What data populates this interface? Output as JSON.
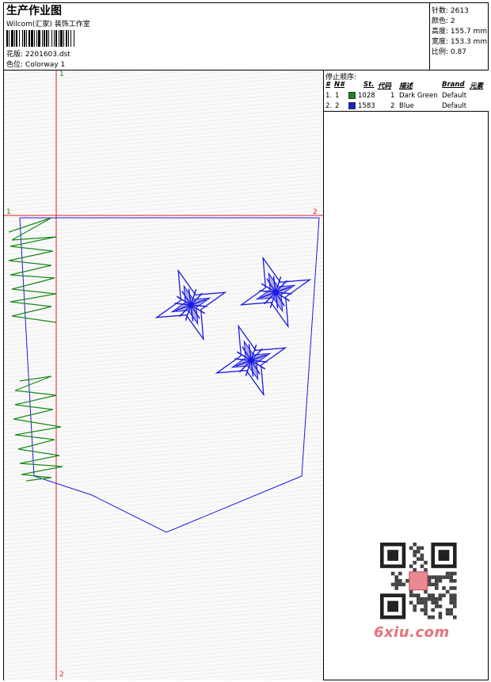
{
  "header": {
    "title": "生产作业图",
    "subtitle": "Wilcom(汇家) 装饰工作室",
    "design_label": "花版:",
    "design_value": "2201603.dst",
    "colorway_label": "色位:",
    "colorway_value": "Colorway 1"
  },
  "stats": {
    "stitches_label": "针数:",
    "stitches_value": "2613",
    "colors_label": "颜色:",
    "colors_value": "2",
    "height_label": "高度:",
    "height_value": "155.7 mm",
    "width_label": "宽度:",
    "width_value": "153.3 mm",
    "scale_label": "比例:",
    "scale_value": "0.87"
  },
  "stop_sequence": {
    "title": "停止顺序:",
    "columns": [
      "#",
      "N#",
      "St.",
      "代码",
      "描述",
      "Brand",
      "元素"
    ],
    "rows": [
      {
        "idx": "1.",
        "n": "1",
        "stitches": "1028",
        "code": "1",
        "desc": "Dark Green",
        "brand": "Default",
        "color": "#1a8a1a"
      },
      {
        "idx": "2.",
        "n": "2",
        "stitches": "1583",
        "code": "2",
        "desc": "Blue",
        "brand": "Default",
        "color": "#1a1ae0"
      }
    ]
  },
  "axis_labels": {
    "top": "1",
    "bottom": "2",
    "left": "1",
    "right": "2"
  },
  "watermark": {
    "logo_text": "6xiu.com"
  },
  "colors": {
    "green": "#1a8a1a",
    "blue": "#1a1ae0",
    "red_axis": "#e02020"
  }
}
